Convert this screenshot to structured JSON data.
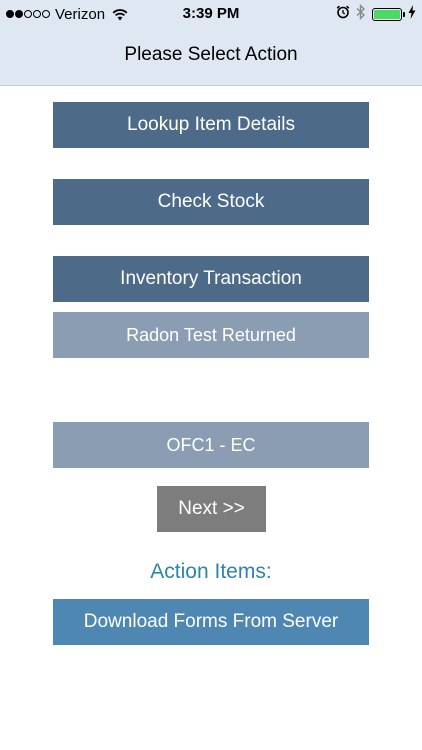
{
  "status_bar": {
    "carrier": "Verizon",
    "time": "3:39 PM",
    "signal_bars_filled": 2,
    "signal_bars_total": 5,
    "battery_level": 1.0,
    "battery_color": "#4cd964",
    "icons": [
      "wifi-icon",
      "alarm-icon",
      "bluetooth-icon",
      "battery-icon",
      "charging-icon"
    ]
  },
  "nav": {
    "title": "Please Select Action"
  },
  "actions": {
    "lookup_item_details": "Lookup Item Details",
    "check_stock": "Check Stock",
    "inventory_transaction": "Inventory Transaction",
    "radon_test_returned": "Radon Test Returned",
    "location_selector": "OFC1 - EC",
    "next": "Next >>"
  },
  "action_items": {
    "heading": "Action Items:",
    "download_forms": "Download Forms From Server"
  },
  "colors": {
    "header_bg": "#dfe7f2",
    "primary_button": "#4d6a88",
    "secondary_button": "#8a9db3",
    "next_button": "#7d7d7d",
    "download_button": "#4f87b3",
    "heading_text": "#2f84ab"
  }
}
